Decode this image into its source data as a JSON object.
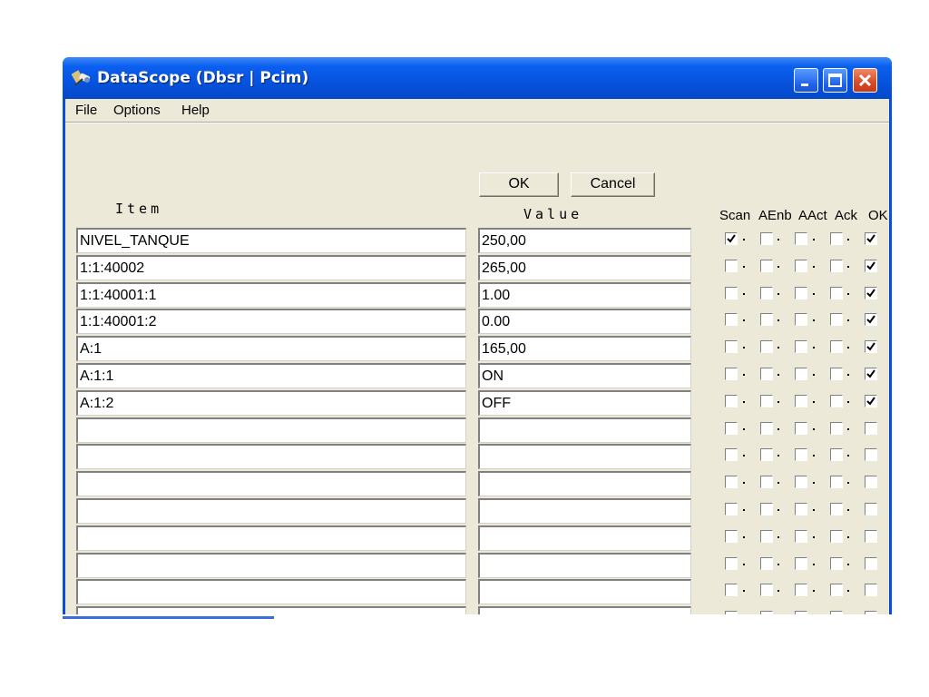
{
  "window": {
    "title": "DataScope (Dbsr | Pcim)",
    "icon": "datascope-app-icon",
    "controls": {
      "minimize_icon": "minimize-icon",
      "maximize_icon": "maximize-icon",
      "close_icon": "close-icon"
    }
  },
  "menu": [
    "File",
    "Options",
    "Help"
  ],
  "buttons": {
    "ok": "OK",
    "cancel": "Cancel"
  },
  "columns": {
    "item": "Item",
    "value": "Value",
    "flags": [
      "Scan",
      "AEnb",
      "AAct",
      "Ack",
      "OK"
    ]
  },
  "rows": [
    {
      "item": "NIVEL_TANQUE",
      "value": "250,00",
      "flags": [
        true,
        false,
        false,
        false,
        true
      ]
    },
    {
      "item": "1:1:40002",
      "value": "265,00",
      "flags": [
        false,
        false,
        false,
        false,
        true
      ]
    },
    {
      "item": "1:1:40001:1",
      "value": "1.00",
      "flags": [
        false,
        false,
        false,
        false,
        true
      ]
    },
    {
      "item": "1:1:40001:2",
      "value": "0.00",
      "flags": [
        false,
        false,
        false,
        false,
        true
      ]
    },
    {
      "item": "A:1",
      "value": "165,00",
      "flags": [
        false,
        false,
        false,
        false,
        true
      ]
    },
    {
      "item": "A:1:1",
      "value": "ON",
      "flags": [
        false,
        false,
        false,
        false,
        true
      ]
    },
    {
      "item": "A:1:2",
      "value": "OFF",
      "flags": [
        false,
        false,
        false,
        false,
        true
      ]
    },
    {
      "item": "",
      "value": "",
      "flags": [
        false,
        false,
        false,
        false,
        false
      ]
    },
    {
      "item": "",
      "value": "",
      "flags": [
        false,
        false,
        false,
        false,
        false
      ]
    },
    {
      "item": "",
      "value": "",
      "flags": [
        false,
        false,
        false,
        false,
        false
      ]
    },
    {
      "item": "",
      "value": "",
      "flags": [
        false,
        false,
        false,
        false,
        false
      ]
    },
    {
      "item": "",
      "value": "",
      "flags": [
        false,
        false,
        false,
        false,
        false
      ]
    },
    {
      "item": "",
      "value": "",
      "flags": [
        false,
        false,
        false,
        false,
        false
      ]
    },
    {
      "item": "",
      "value": "",
      "flags": [
        false,
        false,
        false,
        false,
        false
      ]
    },
    {
      "item": "",
      "value": "",
      "flags": [
        false,
        false,
        false,
        false,
        false
      ]
    },
    {
      "item": "",
      "value": "",
      "flags": [
        false,
        false,
        false,
        false,
        false
      ]
    }
  ],
  "colors": {
    "titlebar": "#0653de",
    "window_frame": "#0a4ddc",
    "client": "#ece9d8",
    "close_button": "#d64a27"
  }
}
